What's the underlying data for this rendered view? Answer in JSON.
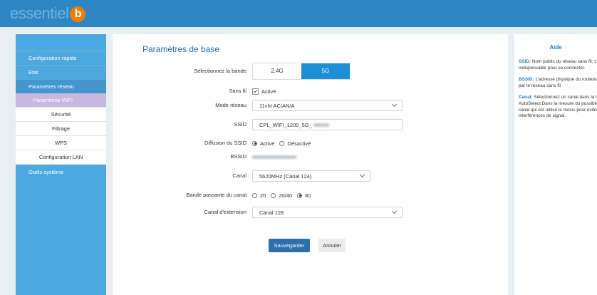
{
  "brand": {
    "name": "essentiel",
    "logo_letter": "b"
  },
  "sidebar": {
    "items": [
      {
        "label": "Configuration rapide"
      },
      {
        "label": "Etat"
      },
      {
        "label": "Paramètres réseau"
      }
    ],
    "sub_items": [
      {
        "label": "Paramètres WiFi",
        "selected": true
      },
      {
        "label": "Sécurité"
      },
      {
        "label": "Filtrage"
      },
      {
        "label": "WPS"
      },
      {
        "label": "Configuration LAN"
      }
    ],
    "tools": {
      "label": "Outils système"
    }
  },
  "main": {
    "title": "Paramètres de base",
    "band": {
      "label": "Sélectionnez la bande",
      "options": [
        "2.4G",
        "5G"
      ],
      "selected": "5G"
    },
    "wireless": {
      "label": "Sans fil",
      "value": "Activé",
      "checked": true
    },
    "mode": {
      "label": "Mode réseau",
      "value": "11vht AC/AN/A"
    },
    "ssid": {
      "label": "SSID",
      "value": "CPL_WIFI_1200_5G_"
    },
    "broadcast": {
      "label": "Diffusion du SSID",
      "options": [
        "Activé",
        "Désactivé"
      ],
      "selected": "Activé"
    },
    "bssid": {
      "label": "BSSID"
    },
    "channel": {
      "label": "Canal",
      "value": "5620MHz (Canal 124)"
    },
    "bandwidth": {
      "label": "Bande passante du canal",
      "options": [
        "20",
        "20/40",
        "80"
      ],
      "selected": "80"
    },
    "ext_channel": {
      "label": "Canal d'extension",
      "value": "Canal 128"
    },
    "save_label": "Sauvegarder",
    "cancel_label": "Annuler"
  },
  "help": {
    "title": "Aide",
    "ssid_term": "SSID:",
    "ssid_text": "Nom public du réseau sans fil. Le SSID est indispensable pour se connecter.",
    "bssid_term": "BSSID:",
    "bssid_text": "L'adresse physique du routeur/point d'accès vu par le réseau sans fil",
    "canal_term": "Canal:",
    "canal_text": "Sélectionnez un canal dans la liste, par défaut AutoSelect.Dans la mesure du possible, sélectionnez le canal qui est utilisé le moins pour éviter les interférences de signal."
  },
  "colors": {
    "topbar": "#2f86c5",
    "sidebar": "#4ea8e0",
    "accent": "#1b8fd8",
    "selected_sub": "#c9b8de",
    "save_button": "#2e6fab"
  }
}
